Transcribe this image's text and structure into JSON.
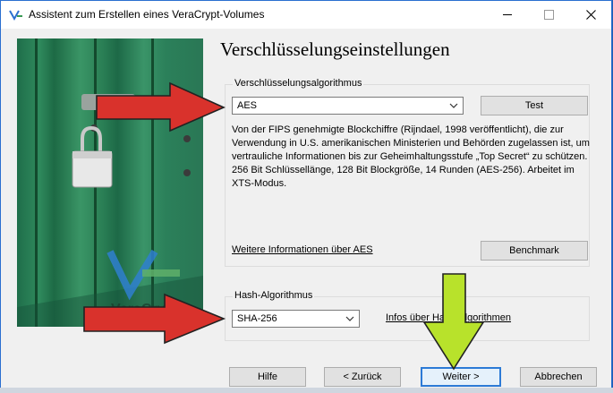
{
  "window": {
    "title": "Assistent zum Erstellen eines VeraCrypt-Volumes"
  },
  "icons": {
    "app": "veracrypt-logo-icon",
    "minimize": "minimize-icon",
    "maximize": "maximize-icon",
    "close": "close-icon",
    "combo_arrow": "chevron-down-icon"
  },
  "side_image": {
    "brand_text": "VeraCrypt"
  },
  "page": {
    "title": "Verschlüsselungseinstellungen"
  },
  "encryption": {
    "group_label": "Verschlüsselungsalgorithmus",
    "selected": "AES",
    "test_label": "Test",
    "description": "Von der FIPS genehmigte Blockchiffre (Rijndael, 1998 veröffentlicht), die zur Verwendung in U.S. amerikanischen Ministerien und Behörden zugelassen ist, um vertrauliche Informationen bis zur Geheimhaltungsstufe „Top Secret“ zu schützen. 256 Bit Schlüssellänge, 128 Bit Blockgröße, 14 Runden (AES-256). Arbeitet im XTS-Modus.",
    "more_info_link": "Weitere Informationen über AES",
    "benchmark_label": "Benchmark"
  },
  "hash": {
    "group_label": "Hash-Algorithmus",
    "selected": "SHA-256",
    "info_link": "Infos über Hash-Algorithmen"
  },
  "footer": {
    "help": "Hilfe",
    "back": "< Zurück",
    "next": "Weiter >",
    "cancel": "Abbrechen"
  },
  "colors": {
    "accent": "#2c7ad6",
    "annotation_red": "#d9322c",
    "annotation_green": "#b8e22b"
  }
}
